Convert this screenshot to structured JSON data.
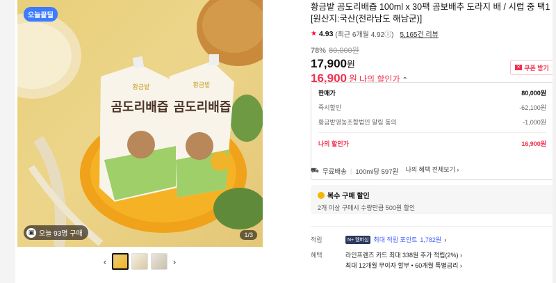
{
  "gallery": {
    "today_badge": "오늘끝딜",
    "buyers_text": "오늘 93명 구매",
    "buyers_icon": "cart-icon",
    "pager": "1/3",
    "product_brand": "황금밭",
    "product_name": "곰도리배즙"
  },
  "product": {
    "title": "황금밭 곰도리배즙 100ml x 30팩 곰보배추 도라지 배 / 시럽 중 택1 [원산지:국산(전라남도 해남군)]",
    "rating": "4.93",
    "rating_detail": "(최근 6개월 4.92ⓘ)",
    "review_count": "5,165건 리뷰",
    "discount_pct": "78%",
    "original_price": "80,000원",
    "price": "17,900",
    "price_unit": "원",
    "my_price": "16,900",
    "my_price_unit": "원",
    "my_price_label": "나의 할인가",
    "coupon_label": "쿠폰 받기"
  },
  "breakdown": {
    "rows": [
      {
        "label": "판매가",
        "value": "80,000원"
      },
      {
        "label": "즉시할인",
        "value": "-62,100원"
      },
      {
        "label": "황금밭영농조합법인 알림 동의",
        "value": "-1,000원"
      }
    ],
    "mine_label": "나의 할인가",
    "mine_value": "16,900원",
    "view_all": "나의 혜택 전체보기 ›"
  },
  "shipping": {
    "free": "무료배송",
    "detail": "100ml당 597원"
  },
  "multi_buy": {
    "title": "복수 구매 할인",
    "desc": "2개 이상 구매시 수량만큼 500원 할인"
  },
  "points": {
    "label": "적립",
    "tag": "N+ 멤버십",
    "text": "최대 적립 포인트",
    "amount": "1,782원",
    "arrow": "›"
  },
  "benefit": {
    "label": "혜택",
    "line1": "라인프렌즈 카드 최대 338원 추가 적립(2%) ›",
    "line2": "최대 12개월 무이자 할부 • 60개월 특별금리 ›"
  },
  "colors": {
    "accent_red": "#f0304e",
    "badge_blue": "#3d7bff"
  }
}
